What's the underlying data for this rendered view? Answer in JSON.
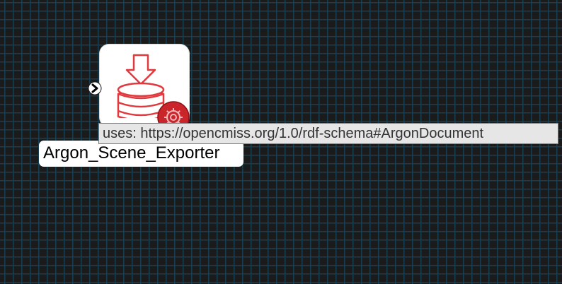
{
  "node": {
    "label": "Argon_Scene_Exporter",
    "icon": "database-download-icon",
    "badge_icon": "gear-icon",
    "port_icon": "chevron-right-icon"
  },
  "tooltip": {
    "text": "uses: https://opencmiss.org/1.0/rdf-schema#ArgonDocument"
  },
  "colors": {
    "canvas_background": "#1b1b1b",
    "grid_line": "#163f52",
    "icon_accent": "#e0393e",
    "badge_fill": "#c9252b",
    "tooltip_background": "#e6e6e6"
  }
}
